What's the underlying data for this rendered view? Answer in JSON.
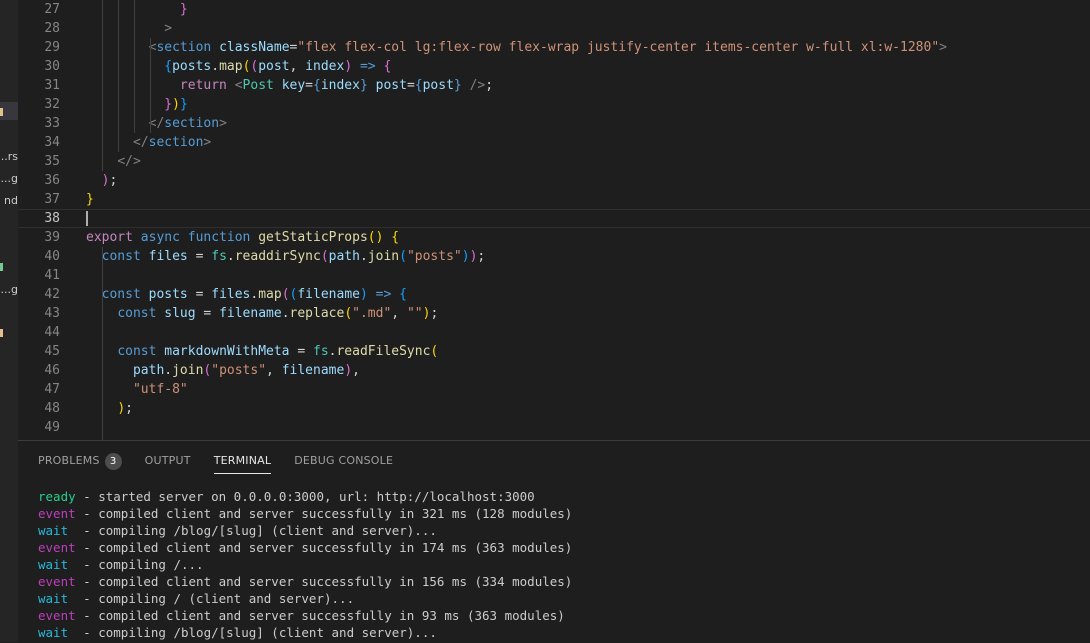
{
  "sidebar_fragments": [
    {
      "text": "rs...",
      "color": "#cccccc"
    },
    {
      "text": "g...",
      "color": "#cccccc"
    },
    {
      "text": "nd",
      "color": "#cccccc"
    },
    {
      "text": "g...",
      "color": "#cccccc"
    }
  ],
  "sidebar_marks": [
    "#e2c08d",
    "#73c991",
    "#e2c08d"
  ],
  "editor": {
    "lines": [
      {
        "n": "27",
        "tokens": [
          [
            "            ",
            "plain"
          ],
          [
            "}",
            "br2"
          ]
        ]
      },
      {
        "n": "28",
        "tokens": [
          [
            "          ",
            "plain"
          ],
          [
            ">",
            "tag"
          ]
        ]
      },
      {
        "n": "29",
        "tokens": [
          [
            "        ",
            "plain"
          ],
          [
            "<",
            "tag"
          ],
          [
            "section",
            "name"
          ],
          [
            " ",
            "plain"
          ],
          [
            "className",
            "attr"
          ],
          [
            "=",
            "plain"
          ],
          [
            "\"flex flex-col lg:flex-row flex-wrap justify-center items-center w-full xl:w-1280\"",
            "str"
          ],
          [
            ">",
            "tag"
          ]
        ]
      },
      {
        "n": "30",
        "tokens": [
          [
            "          ",
            "plain"
          ],
          [
            "{",
            "br3"
          ],
          [
            "posts",
            "var"
          ],
          [
            ".",
            "plain"
          ],
          [
            "map",
            "fn"
          ],
          [
            "(",
            "br1"
          ],
          [
            "(",
            "br2"
          ],
          [
            "post",
            "var"
          ],
          [
            ", ",
            "plain"
          ],
          [
            "index",
            "var"
          ],
          [
            ")",
            "br2"
          ],
          [
            " ",
            "plain"
          ],
          [
            "=>",
            "kw"
          ],
          [
            " ",
            "plain"
          ],
          [
            "{",
            "br2"
          ]
        ]
      },
      {
        "n": "31",
        "tokens": [
          [
            "            ",
            "plain"
          ],
          [
            "return",
            "kw2"
          ],
          [
            " ",
            "plain"
          ],
          [
            "<",
            "tag"
          ],
          [
            "Post",
            "comp"
          ],
          [
            " ",
            "plain"
          ],
          [
            "key",
            "attr"
          ],
          [
            "=",
            "plain"
          ],
          [
            "{",
            "kw"
          ],
          [
            "index",
            "var"
          ],
          [
            "}",
            "kw"
          ],
          [
            " ",
            "plain"
          ],
          [
            "post",
            "attr"
          ],
          [
            "=",
            "plain"
          ],
          [
            "{",
            "kw"
          ],
          [
            "post",
            "var"
          ],
          [
            "}",
            "kw"
          ],
          [
            " ",
            "plain"
          ],
          [
            "/>",
            "tag"
          ],
          [
            ";",
            "plain"
          ]
        ]
      },
      {
        "n": "32",
        "tokens": [
          [
            "          ",
            "plain"
          ],
          [
            "}",
            "br2"
          ],
          [
            ")",
            "br1"
          ],
          [
            "}",
            "br3"
          ]
        ]
      },
      {
        "n": "33",
        "tokens": [
          [
            "        ",
            "plain"
          ],
          [
            "</",
            "tag"
          ],
          [
            "section",
            "name"
          ],
          [
            ">",
            "tag"
          ]
        ]
      },
      {
        "n": "34",
        "tokens": [
          [
            "      ",
            "plain"
          ],
          [
            "</",
            "tag"
          ],
          [
            "section",
            "name"
          ],
          [
            ">",
            "tag"
          ]
        ]
      },
      {
        "n": "35",
        "tokens": [
          [
            "    ",
            "plain"
          ],
          [
            "</",
            "tag"
          ],
          [
            ">",
            "tag"
          ]
        ]
      },
      {
        "n": "36",
        "tokens": [
          [
            "  ",
            "plain"
          ],
          [
            ")",
            "br2"
          ],
          [
            ";",
            "plain"
          ]
        ]
      },
      {
        "n": "37",
        "tokens": [
          [
            "}",
            "br1"
          ]
        ]
      },
      {
        "n": "38",
        "tokens": []
      },
      {
        "n": "39",
        "tokens": [
          [
            "export",
            "kw2"
          ],
          [
            " ",
            "plain"
          ],
          [
            "async",
            "kw"
          ],
          [
            " ",
            "plain"
          ],
          [
            "function",
            "kw"
          ],
          [
            " ",
            "plain"
          ],
          [
            "getStaticProps",
            "fn"
          ],
          [
            "()",
            "br1"
          ],
          [
            " ",
            "plain"
          ],
          [
            "{",
            "br1"
          ]
        ]
      },
      {
        "n": "40",
        "tokens": [
          [
            "  ",
            "plain"
          ],
          [
            "const",
            "kw"
          ],
          [
            " ",
            "plain"
          ],
          [
            "files",
            "var"
          ],
          [
            " = ",
            "plain"
          ],
          [
            "fs",
            "comp"
          ],
          [
            ".",
            "plain"
          ],
          [
            "readdirSync",
            "fn"
          ],
          [
            "(",
            "br2"
          ],
          [
            "path",
            "var"
          ],
          [
            ".",
            "plain"
          ],
          [
            "join",
            "fn"
          ],
          [
            "(",
            "br3"
          ],
          [
            "\"posts\"",
            "str"
          ],
          [
            ")",
            "br3"
          ],
          [
            ")",
            "br2"
          ],
          [
            ";",
            "plain"
          ]
        ]
      },
      {
        "n": "41",
        "tokens": []
      },
      {
        "n": "42",
        "tokens": [
          [
            "  ",
            "plain"
          ],
          [
            "const",
            "kw"
          ],
          [
            " ",
            "plain"
          ],
          [
            "posts",
            "var"
          ],
          [
            " = ",
            "plain"
          ],
          [
            "files",
            "var"
          ],
          [
            ".",
            "plain"
          ],
          [
            "map",
            "fn"
          ],
          [
            "(",
            "br2"
          ],
          [
            "(",
            "br3"
          ],
          [
            "filename",
            "var"
          ],
          [
            ")",
            "br3"
          ],
          [
            " ",
            "plain"
          ],
          [
            "=>",
            "kw"
          ],
          [
            " ",
            "plain"
          ],
          [
            "{",
            "br3"
          ]
        ]
      },
      {
        "n": "43",
        "tokens": [
          [
            "    ",
            "plain"
          ],
          [
            "const",
            "kw"
          ],
          [
            " ",
            "plain"
          ],
          [
            "slug",
            "var"
          ],
          [
            " = ",
            "plain"
          ],
          [
            "filename",
            "var"
          ],
          [
            ".",
            "plain"
          ],
          [
            "replace",
            "fn"
          ],
          [
            "(",
            "br1"
          ],
          [
            "\".md\"",
            "str"
          ],
          [
            ", ",
            "plain"
          ],
          [
            "\"\"",
            "str"
          ],
          [
            ")",
            "br1"
          ],
          [
            ";",
            "plain"
          ]
        ]
      },
      {
        "n": "44",
        "tokens": []
      },
      {
        "n": "45",
        "tokens": [
          [
            "    ",
            "plain"
          ],
          [
            "const",
            "kw"
          ],
          [
            " ",
            "plain"
          ],
          [
            "markdownWithMeta",
            "var"
          ],
          [
            " = ",
            "plain"
          ],
          [
            "fs",
            "comp"
          ],
          [
            ".",
            "plain"
          ],
          [
            "readFileSync",
            "fn"
          ],
          [
            "(",
            "br1"
          ]
        ]
      },
      {
        "n": "46",
        "tokens": [
          [
            "      ",
            "plain"
          ],
          [
            "path",
            "var"
          ],
          [
            ".",
            "plain"
          ],
          [
            "join",
            "fn"
          ],
          [
            "(",
            "br2"
          ],
          [
            "\"posts\"",
            "str"
          ],
          [
            ", ",
            "plain"
          ],
          [
            "filename",
            "var"
          ],
          [
            ")",
            "br2"
          ],
          [
            ",",
            "plain"
          ]
        ]
      },
      {
        "n": "47",
        "tokens": [
          [
            "      ",
            "plain"
          ],
          [
            "\"utf-8\"",
            "str"
          ]
        ]
      },
      {
        "n": "48",
        "tokens": [
          [
            "    ",
            "plain"
          ],
          [
            ")",
            "br1"
          ],
          [
            ";",
            "plain"
          ]
        ]
      },
      {
        "n": "49",
        "tokens": []
      }
    ],
    "current_line": "38"
  },
  "panel": {
    "tabs": [
      {
        "id": "problems",
        "label": "PROBLEMS",
        "badge": "3",
        "active": false
      },
      {
        "id": "output",
        "label": "OUTPUT",
        "active": false
      },
      {
        "id": "terminal",
        "label": "TERMINAL",
        "active": true
      },
      {
        "id": "debug-console",
        "label": "DEBUG CONSOLE",
        "active": false
      }
    ]
  },
  "terminal": {
    "lines": [
      {
        "level": "ready",
        "pad": "",
        "message": " - started server on 0.0.0.0:3000, url: http://localhost:3000"
      },
      {
        "level": "event",
        "pad": "",
        "message": " - compiled client and server successfully in 321 ms (128 modules)"
      },
      {
        "level": "wait",
        "pad": " ",
        "message": " - compiling /blog/[slug] (client and server)..."
      },
      {
        "level": "event",
        "pad": "",
        "message": " - compiled client and server successfully in 174 ms (363 modules)"
      },
      {
        "level": "wait",
        "pad": " ",
        "message": " - compiling /..."
      },
      {
        "level": "event",
        "pad": "",
        "message": " - compiled client and server successfully in 156 ms (334 modules)"
      },
      {
        "level": "wait",
        "pad": " ",
        "message": " - compiling / (client and server)..."
      },
      {
        "level": "event",
        "pad": "",
        "message": " - compiled client and server successfully in 93 ms (363 modules)"
      },
      {
        "level": "wait",
        "pad": " ",
        "message": " - compiling /blog/[slug] (client and server)..."
      }
    ]
  }
}
